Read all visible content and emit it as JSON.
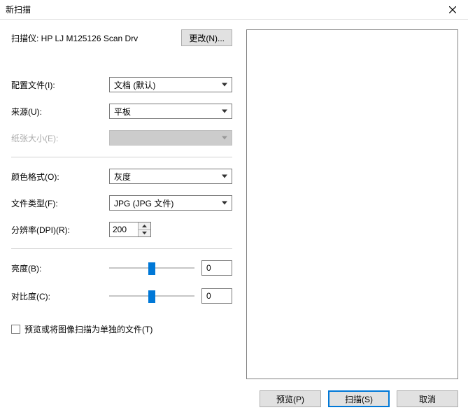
{
  "title": "新扫描",
  "scanner": {
    "label": "扫描仪: HP LJ M125126 Scan Drv",
    "change_label": "更改(N)..."
  },
  "profile": {
    "label": "配置文件(I):",
    "value": "文档 (默认)"
  },
  "source": {
    "label": "来源(U):",
    "value": "平板"
  },
  "paper_size": {
    "label": "纸张大小(E):",
    "value": ""
  },
  "color_format": {
    "label": "颜色格式(O):",
    "value": "灰度"
  },
  "file_type": {
    "label": "文件类型(F):",
    "value": "JPG (JPG 文件)"
  },
  "resolution": {
    "label": "分辨率(DPI)(R):",
    "value": "200"
  },
  "brightness": {
    "label": "亮度(B):",
    "value": "0"
  },
  "contrast": {
    "label": "对比度(C):",
    "value": "0"
  },
  "separate_files": {
    "label": "预览或将图像扫描为单独的文件(T)"
  },
  "buttons": {
    "preview": "预览(P)",
    "scan": "扫描(S)",
    "cancel": "取消"
  }
}
